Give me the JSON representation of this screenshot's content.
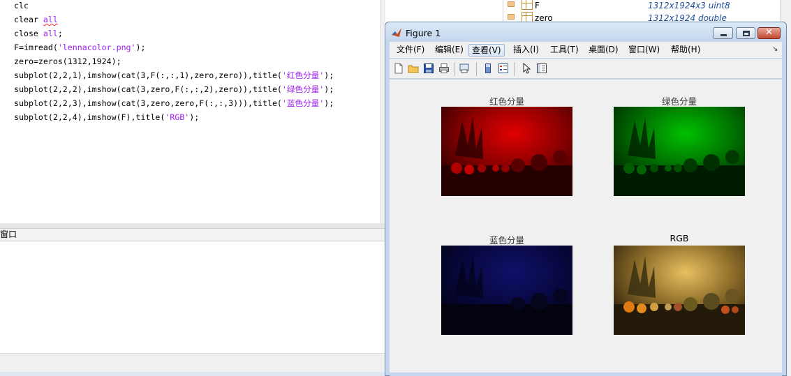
{
  "editor": {
    "lines": [
      {
        "plain": "clc"
      },
      {
        "pre": "clear ",
        "kw": "all"
      },
      {
        "pre": "close ",
        "kw": "all",
        "post": ";"
      },
      {
        "pre": "F=imread(",
        "str": "'lennacolor.png'",
        "post": ");"
      },
      {
        "plain": "zero=zeros(1312,1924);"
      },
      {
        "pre": "subplot(2,2,1),imshow(cat(3,F(:,:,1),zero,zero)),title(",
        "str": "'红色分量'",
        "post": ");"
      },
      {
        "pre": "subplot(2,2,2),imshow(cat(3,zero,F(:,:,2),zero)),title(",
        "str": "'绿色分量'",
        "post": ");"
      },
      {
        "pre": "subplot(2,2,3),imshow(cat(3,zero,zero,F(:,:,3))),title(",
        "str": "'蓝色分量'",
        "post": ");"
      },
      {
        "pre": "subplot(2,2,4),imshow(F),title(",
        "str": "'RGB'",
        "post": ");"
      }
    ]
  },
  "workspace": {
    "rows": [
      {
        "name": "F",
        "value": "1312x1924x3 uint8"
      },
      {
        "name": "zero",
        "value": "1312x1924 double"
      }
    ]
  },
  "command_window": {
    "label": "窗口"
  },
  "figure": {
    "title": "Figure 1",
    "menu": [
      "文件(F)",
      "编辑(E)",
      "查看(V)",
      "插入(I)",
      "工具(T)",
      "桌面(D)",
      "窗口(W)",
      "帮助(H)"
    ],
    "close_glyph": "✕",
    "subplots": [
      {
        "title": "红色分量",
        "channel": "red"
      },
      {
        "title": "绿色分量",
        "channel": "green"
      },
      {
        "title": "蓝色分量",
        "channel": "blue"
      },
      {
        "title": "RGB",
        "channel": "rgb"
      }
    ],
    "toolbar_icons": [
      "new-file-icon",
      "open-folder-icon",
      "save-icon",
      "print-icon",
      "print-preview-icon",
      "colorbar-icon",
      "legend-icon",
      "select-arrow-icon",
      "property-editor-icon"
    ]
  },
  "colors": {
    "keyword": "#a020f0",
    "workspace_value": "#1f4e9c",
    "menu_active": "#d9e6f4"
  }
}
